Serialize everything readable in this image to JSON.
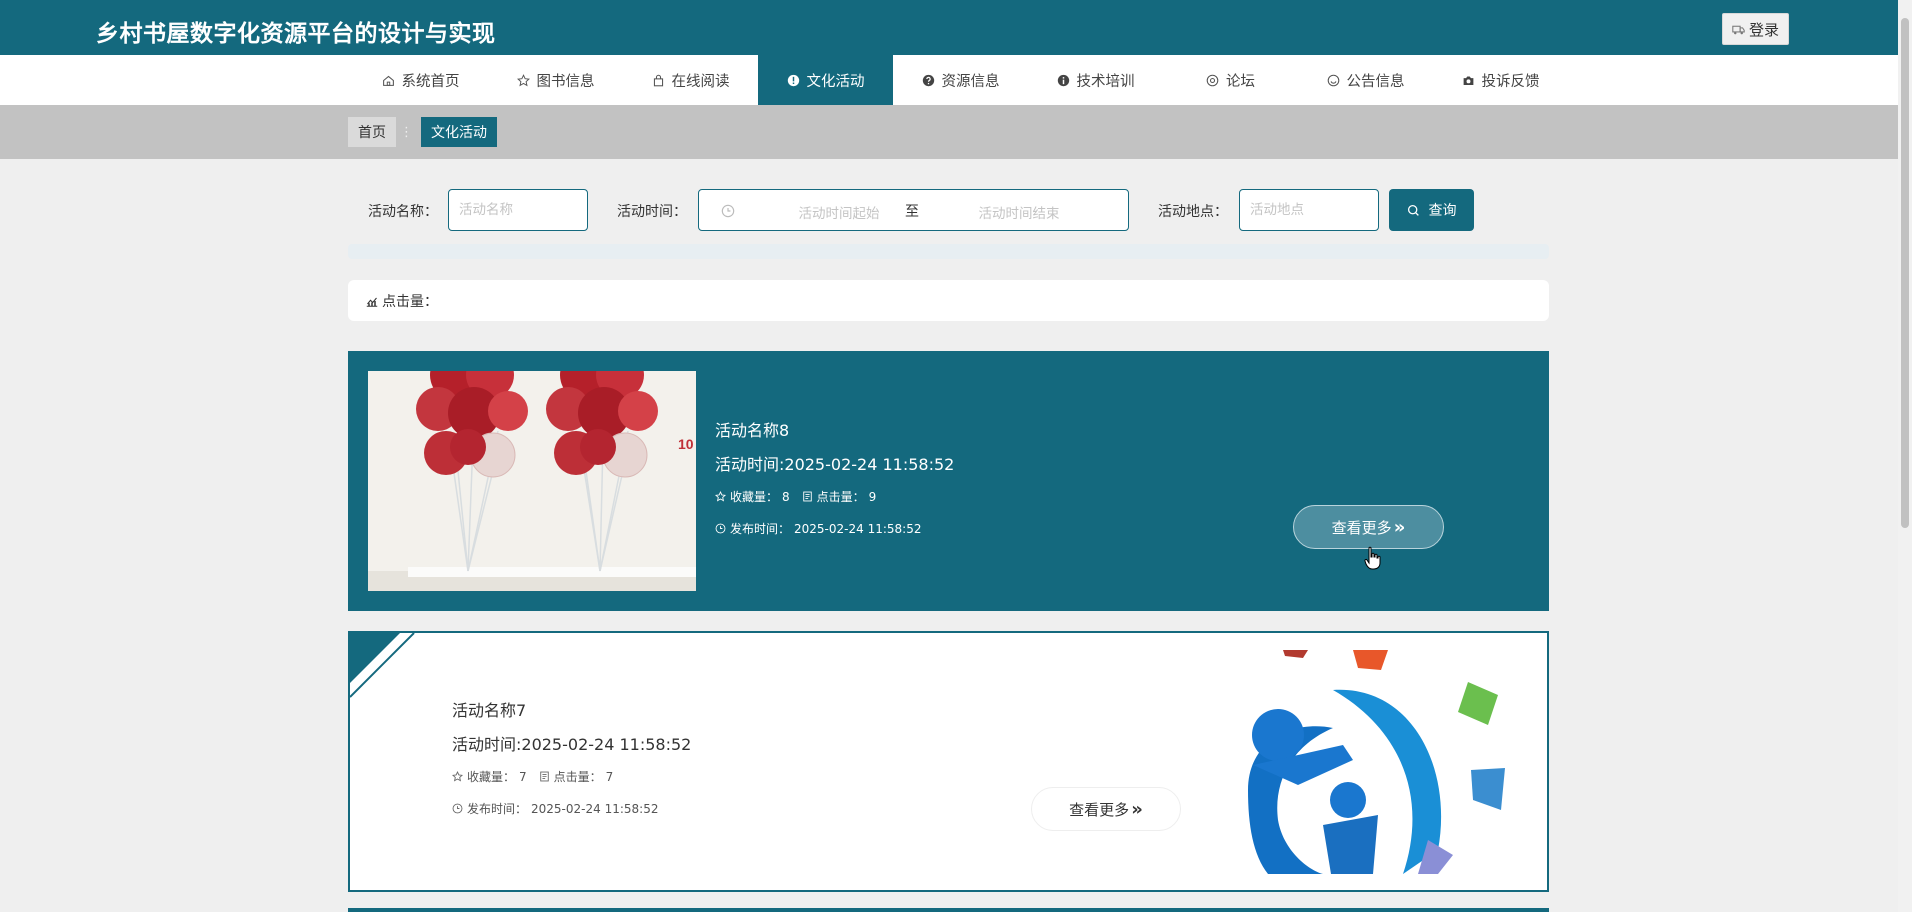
{
  "header": {
    "title": "乡村书屋数字化资源平台的设计与实现",
    "login_label": "登录"
  },
  "nav": {
    "items": [
      {
        "label": "系统首页",
        "icon": "home-icon"
      },
      {
        "label": "图书信息",
        "icon": "star-icon"
      },
      {
        "label": "在线阅读",
        "icon": "bag-icon"
      },
      {
        "label": "文化活动",
        "icon": "alert-circle-icon"
      },
      {
        "label": "资源信息",
        "icon": "question-circle-icon"
      },
      {
        "label": "技术培训",
        "icon": "info-circle-icon"
      },
      {
        "label": "论坛",
        "icon": "at-icon"
      },
      {
        "label": "公告信息",
        "icon": "smile-icon"
      },
      {
        "label": "投诉反馈",
        "icon": "camera-icon"
      }
    ],
    "active_index": 3
  },
  "breadcrumb": {
    "home": "首页",
    "separator": "⋮",
    "current": "文化活动"
  },
  "search": {
    "name_label": "活动名称：",
    "name_placeholder": "活动名称",
    "time_label": "活动时间：",
    "time_start_placeholder": "活动时间起始",
    "time_separator": "至",
    "time_end_placeholder": "活动时间结束",
    "place_label": "活动地点：",
    "place_placeholder": "活动地点",
    "button_label": "查询"
  },
  "sort": {
    "label": "点击量："
  },
  "activities": [
    {
      "title": "活动名称8",
      "time": "活动时间:2025-02-24 11:58:52",
      "favorites_label": "收藏量：",
      "favorites": "8",
      "clicks_label": "点击量：",
      "clicks": "9",
      "published_label": "发布时间：",
      "published": "2025-02-24 11:58:52",
      "more_label": "查看更多",
      "more_icon": "»"
    },
    {
      "title": "活动名称7",
      "time": "活动时间:2025-02-24 11:58:52",
      "favorites_label": "收藏量：",
      "favorites": "7",
      "clicks_label": "点击量：",
      "clicks": "7",
      "published_label": "发布时间：",
      "published": "2025-02-24 11:58:52",
      "more_label": "查看更多",
      "more_icon": "»"
    }
  ],
  "colors": {
    "primary": "#14697e",
    "breadcrumb_bar": "#c2c2c2",
    "page_bg": "#efefef"
  }
}
